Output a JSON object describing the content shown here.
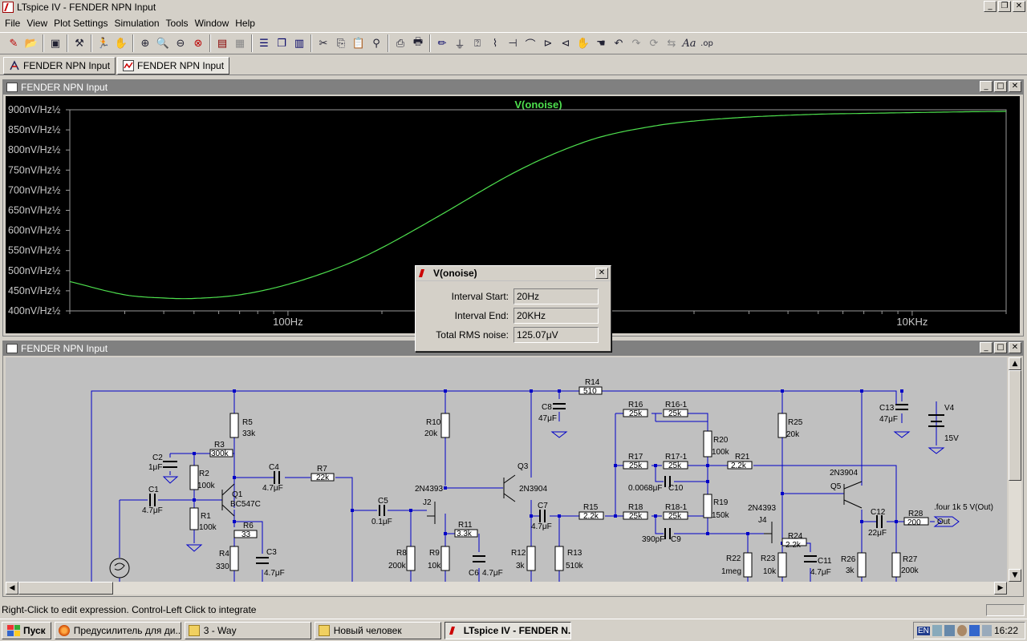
{
  "window": {
    "title": "LTspice IV - FENDER NPN Input"
  },
  "menu": [
    "File",
    "View",
    "Plot Settings",
    "Simulation",
    "Tools",
    "Window",
    "Help"
  ],
  "toolbar_icons": [
    "new-schematic-icon",
    "open-icon",
    "save-icon",
    "control-panel-icon",
    "run-icon",
    "halt-icon",
    "zoom-in-icon",
    "zoom-pan-icon",
    "zoom-out-icon",
    "zoom-cancel-icon",
    "autorange-icon",
    "grid-icon",
    "tile-horizontal-icon",
    "cascade-icon",
    "tile-vertical-icon",
    "cut-icon",
    "copy-icon",
    "paste-icon",
    "find-icon",
    "print-setup-icon",
    "print-icon",
    "wire-icon",
    "ground-icon",
    "label-net-icon",
    "resistor-icon",
    "capacitor-icon",
    "inductor-icon",
    "diode-icon",
    "component-icon",
    "move-icon",
    "drag-icon",
    "undo-icon",
    "redo-icon",
    "rotate-icon",
    "mirror-icon",
    "text-icon",
    "spice-directive-icon"
  ],
  "tabs": [
    {
      "label": "FENDER NPN Input",
      "icon": "schematic-icon",
      "active": false
    },
    {
      "label": "FENDER NPN Input",
      "icon": "waveform-icon",
      "active": true
    }
  ],
  "plot_window": {
    "title": "FENDER NPN Input",
    "trace_label": "V(onoise)",
    "trace_color": "#4ee04e"
  },
  "schematic_window": {
    "title": "FENDER NPN Input"
  },
  "chart_data": {
    "type": "line",
    "title": "V(onoise)",
    "x_scale": "log",
    "xlim": [
      20,
      20000
    ],
    "ylim": [
      400,
      900
    ],
    "y_ticks": [
      "900nV/Hz½",
      "850nV/Hz½",
      "800nV/Hz½",
      "750nV/Hz½",
      "700nV/Hz½",
      "650nV/Hz½",
      "600nV/Hz½",
      "550nV/Hz½",
      "500nV/Hz½",
      "450nV/Hz½",
      "400nV/Hz½"
    ],
    "y_tick_values": [
      900,
      850,
      800,
      750,
      700,
      650,
      600,
      550,
      500,
      450,
      400
    ],
    "x_ticks": [
      "100Hz",
      "10KHz"
    ],
    "x_tick_values": [
      100,
      10000
    ],
    "series": [
      {
        "name": "V(onoise)",
        "x": [
          20,
          30,
          40,
          50,
          70,
          100,
          150,
          200,
          300,
          500,
          700,
          1000,
          1500,
          2000,
          3000,
          5000,
          7000,
          10000,
          15000,
          20000
        ],
        "y": [
          473,
          440,
          432,
          431,
          440,
          466,
          512,
          557,
          633,
          733,
          788,
          832,
          860,
          872,
          882,
          889,
          891,
          893,
          895,
          896
        ]
      }
    ],
    "grid": false
  },
  "dialog": {
    "title": "V(onoise)",
    "rows": [
      {
        "label": "Interval Start:",
        "value": "20Hz"
      },
      {
        "label": "Interval End:",
        "value": "20KHz"
      },
      {
        "label": "Total RMS noise:",
        "value": "125.07μV"
      }
    ]
  },
  "schematic_labels": {
    "R14": "R14",
    "R14v": "510",
    "R5": "R5",
    "R5v": "33k",
    "R3": "R3",
    "R3v": "300k",
    "C2": "C2",
    "C2v": "1μF",
    "R2": "R2",
    "R2v": "100k",
    "Q1": "Q1",
    "Q1v": "BC547C",
    "C1": "C1",
    "C1v": "4.7μF",
    "R1": "R1",
    "R1v": "100k",
    "C4": "C4",
    "C4v": "4.7μF",
    "R7": "R7",
    "R7v": "22k",
    "R6": "R6",
    "R6v": "33",
    "R4": "R4",
    "R4v": "330",
    "C3": "C3",
    "C3v": "4.7μF",
    "C5": "C5",
    "C5v": "0.1μF",
    "R10": "R10",
    "R10v": "20k",
    "J2n": "2N4393",
    "J2": "J2",
    "R11": "R11",
    "R11v": "3.3k",
    "R8": "R8",
    "R8v": "200k",
    "R9": "R9",
    "R9v": "10k",
    "C6": "C6",
    "C6v": "4.7μF",
    "Q3": "Q3",
    "Q3v": "2N3904",
    "C8": "C8",
    "C8v": "47μF",
    "C7": "C7",
    "C7v": "4.7μF",
    "R12": "R12",
    "R12v": "3k",
    "R13": "R13",
    "R13v": "510k",
    "R15": "R15",
    "R15v": "2.2k",
    "R16": "R16",
    "R16v": "25k",
    "R161": "R16-1",
    "R161v": "25k",
    "R17": "R17",
    "R17v": "25k",
    "R171": "R17-1",
    "R171v": "25k",
    "C10": "C10",
    "C10v": "0.0068μF",
    "R18": "R18",
    "R18v": "25k",
    "R181": "R18-1",
    "R181v": "25k",
    "C9": "C9",
    "C9v": "390pF",
    "R20": "R20",
    "R20v": "100k",
    "R19": "R19",
    "R19v": "150k",
    "R21": "R21",
    "R21v": "2.2k",
    "R25": "R25",
    "R25v": "20k",
    "J4n": "2N4393",
    "J4": "J4",
    "R24": "R24",
    "R24v": "2.2k",
    "R22": "R22",
    "R22v": "1meg",
    "R23": "R23",
    "R23v": "10k",
    "C11": "C11",
    "C11v": "4.7μF",
    "Q5n": "2N3904",
    "Q5": "Q5",
    "C12": "C12",
    "C12v": "22μF",
    "R26": "R26",
    "R26v": "3k",
    "R27": "R27",
    "R27v": "200k",
    "R28": "R28",
    "R28v": "200",
    "C13": "C13",
    "C13v": "47μF",
    "V4": "V4",
    "V4v": "15V",
    "four": ".four 1k 5 V(Out)",
    "out": "Out"
  },
  "status": {
    "text": "Right-Click to edit expression. Control-Left Click to integrate"
  },
  "taskbar": {
    "start": "Пуск",
    "tasks": [
      {
        "label": "Предусилитель для ди...",
        "icon": "firefox-icon",
        "pressed": false
      },
      {
        "label": "3 - Way",
        "icon": "folder-icon",
        "pressed": false
      },
      {
        "label": "Новый человек",
        "icon": "folder-icon",
        "pressed": false
      },
      {
        "label": "LTspice IV - FENDER N...",
        "icon": "ltspice-icon",
        "pressed": true
      }
    ],
    "lang": "EN",
    "clock": "16:22"
  }
}
